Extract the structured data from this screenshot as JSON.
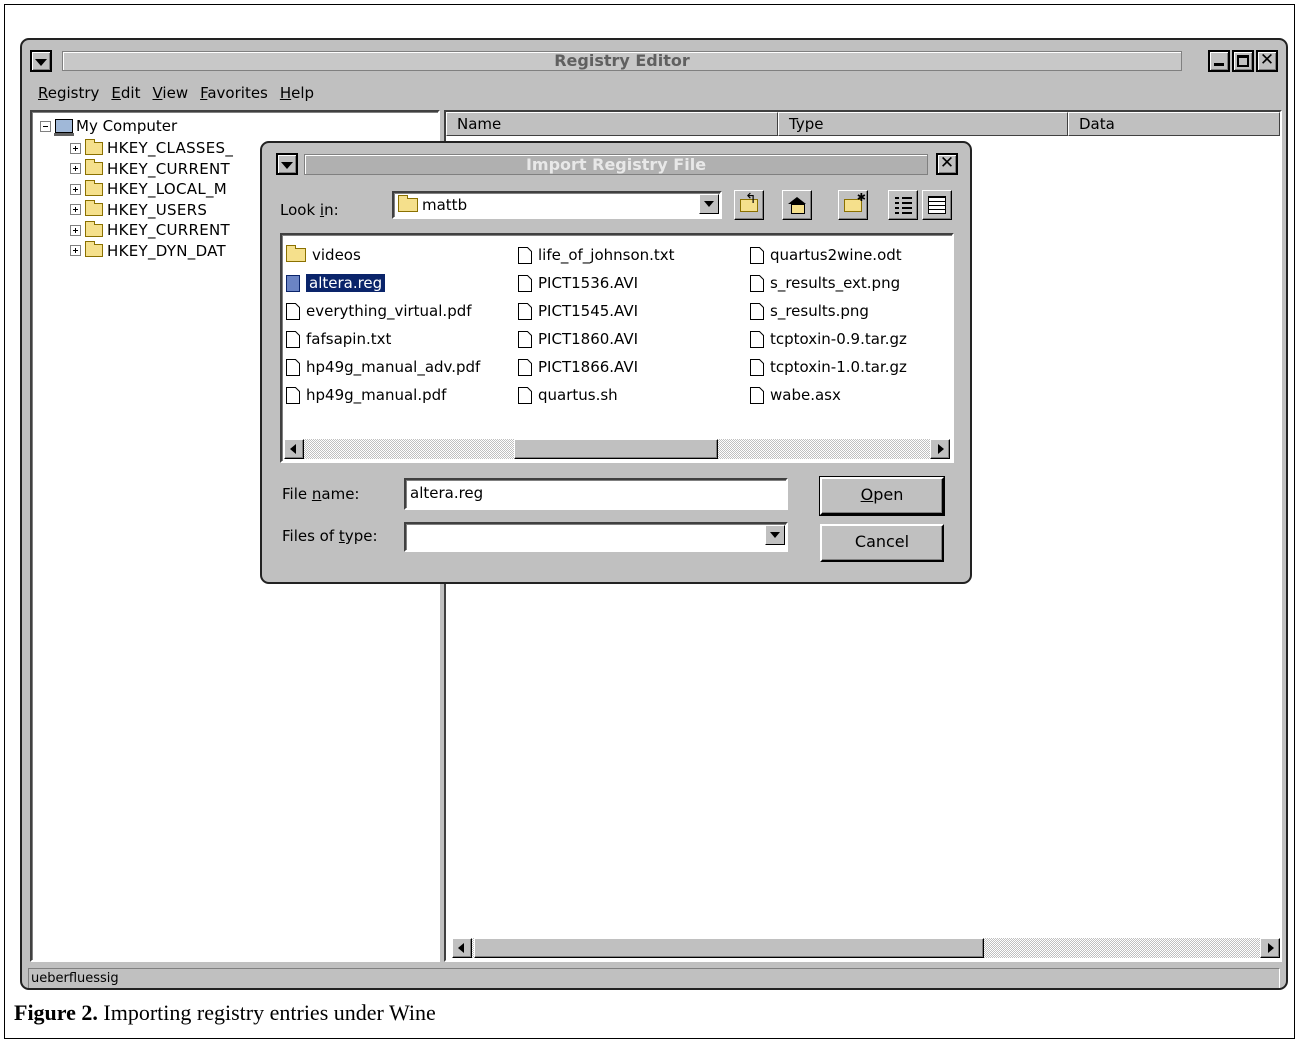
{
  "window": {
    "title": "Registry Editor",
    "menu": [
      {
        "accel": "R",
        "rest": "egistry"
      },
      {
        "accel": "E",
        "rest": "dit"
      },
      {
        "accel": "V",
        "rest": "iew"
      },
      {
        "accel": "F",
        "rest": "avorites"
      },
      {
        "accel": "H",
        "rest": "elp"
      }
    ],
    "status": "ueberfluessig"
  },
  "tree": {
    "root": "My Computer",
    "items": [
      {
        "label": "HKEY_CLASSES_"
      },
      {
        "label": "HKEY_CURRENT"
      },
      {
        "label": "HKEY_LOCAL_M"
      },
      {
        "label": "HKEY_USERS"
      },
      {
        "label": "HKEY_CURRENT"
      },
      {
        "label": "HKEY_DYN_DAT"
      }
    ]
  },
  "list": {
    "columns": [
      "Name",
      "Type",
      "Data"
    ]
  },
  "dialog": {
    "title": "Import Registry File",
    "look_in_label": {
      "pre": "Look ",
      "accel": "i",
      "post": "n:"
    },
    "look_in_value": "mattb",
    "files": [
      [
        {
          "name": "videos",
          "kind": "folder",
          "selected": false
        },
        {
          "name": "altera.reg",
          "kind": "file",
          "selected": true
        },
        {
          "name": "everything_virtual.pdf",
          "kind": "file",
          "selected": false
        },
        {
          "name": "fafsapin.txt",
          "kind": "file",
          "selected": false
        },
        {
          "name": "hp49g_manual_adv.pdf",
          "kind": "file",
          "selected": false
        },
        {
          "name": "hp49g_manual.pdf",
          "kind": "file",
          "selected": false
        }
      ],
      [
        {
          "name": "life_of_johnson.txt",
          "kind": "file",
          "selected": false
        },
        {
          "name": "PICT1536.AVI",
          "kind": "file",
          "selected": false
        },
        {
          "name": "PICT1545.AVI",
          "kind": "file",
          "selected": false
        },
        {
          "name": "PICT1860.AVI",
          "kind": "file",
          "selected": false
        },
        {
          "name": "PICT1866.AVI",
          "kind": "file",
          "selected": false
        },
        {
          "name": "quartus.sh",
          "kind": "file",
          "selected": false
        }
      ],
      [
        {
          "name": "quartus2wine.odt",
          "kind": "file",
          "selected": false
        },
        {
          "name": "s_results_ext.png",
          "kind": "file",
          "selected": false
        },
        {
          "name": "s_results.png",
          "kind": "file",
          "selected": false
        },
        {
          "name": "tcptoxin-0.9.tar.gz",
          "kind": "file",
          "selected": false
        },
        {
          "name": "tcptoxin-1.0.tar.gz",
          "kind": "file",
          "selected": false
        },
        {
          "name": "wabe.asx",
          "kind": "file",
          "selected": false
        }
      ]
    ],
    "filename_label": {
      "pre": "File ",
      "accel": "n",
      "post": "ame:"
    },
    "filename_value": "altera.reg",
    "filetype_label": {
      "pre": "Files of ",
      "accel": "t",
      "post": "ype:"
    },
    "filetype_value": "",
    "open_label": {
      "pre": "",
      "accel": "O",
      "post": "pen"
    },
    "cancel_label": "Cancel"
  },
  "caption": {
    "bold": "Figure 2.",
    "text": " Importing registry entries under Wine"
  }
}
